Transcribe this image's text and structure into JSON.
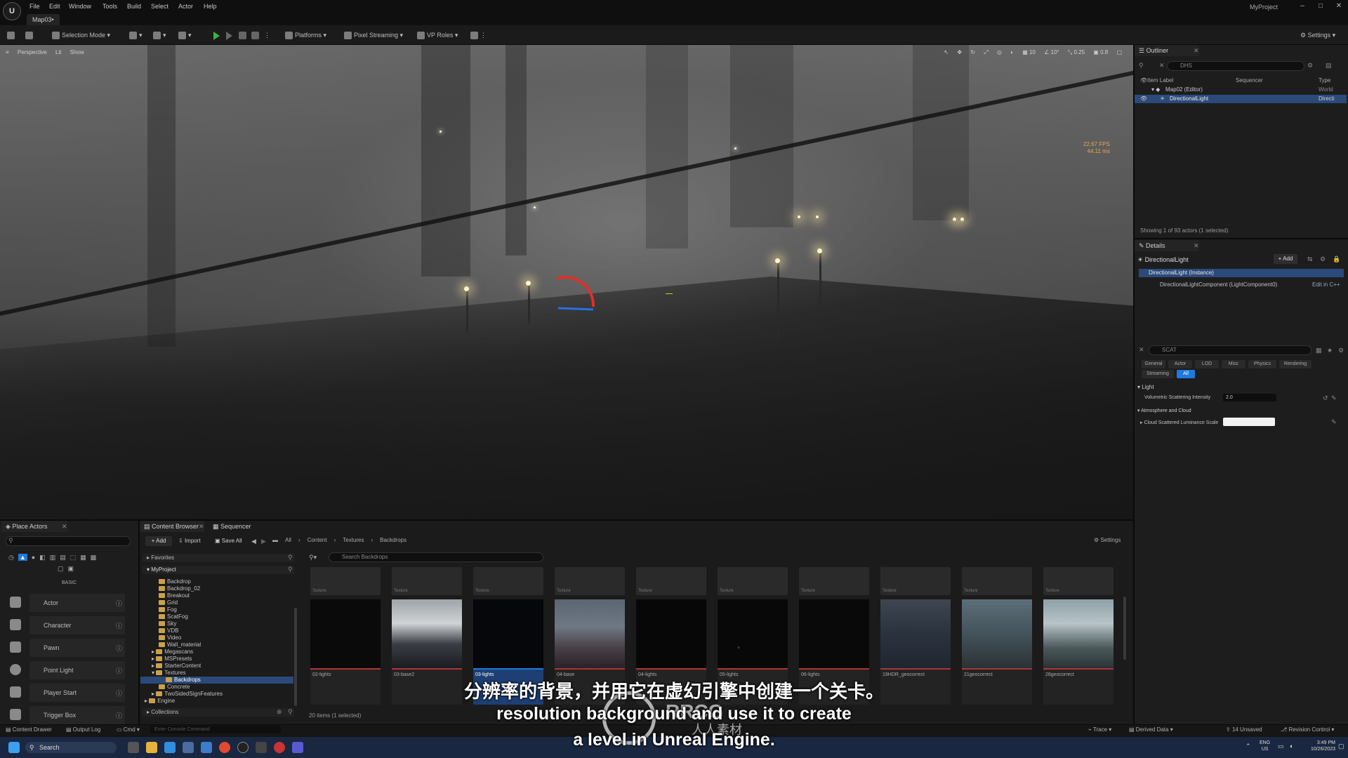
{
  "app": {
    "menu": [
      "File",
      "Edit",
      "Window",
      "Tools",
      "Build",
      "Select",
      "Actor",
      "Help"
    ],
    "project_name": "MyProject",
    "map_tab": "Map03•"
  },
  "toolbar": {
    "selection_mode": "Selection Mode",
    "platforms": "Platforms",
    "pixel_streaming": "Pixel Streaming",
    "vp_roles": "VP Roles",
    "settings": "Settings"
  },
  "viewport": {
    "perspective": "Perspective",
    "lit": "Lit",
    "show": "Show",
    "grid_value": "10",
    "angle_value": "10°",
    "scale_value": "0.25",
    "camera_speed": "0.8",
    "fps": "22.67 FPS",
    "ms": "44.11 ms"
  },
  "outliner": {
    "tab": "Outliner",
    "search": "DHS",
    "col_label": "Item Label",
    "col_sequencer": "Sequencer",
    "col_type": "Type",
    "rows": [
      {
        "label": "Map02 (Editor)",
        "type": "World"
      },
      {
        "label": "DirectionalLight",
        "type": "Directi"
      }
    ],
    "status": "Showing 1 of 93 actors (1 selected)"
  },
  "details": {
    "tab": "Details",
    "actor_name": "DirectionalLight",
    "add_label": "+ Add",
    "instance": "DirectionalLight (Instance)",
    "component": "DirectionalLightComponent (LightComponent0)",
    "edit_cpp": "Edit in C++",
    "search": "SCAT",
    "filters": [
      "General",
      "Actor",
      "LOD",
      "Misc",
      "Physics",
      "Rendering",
      "Streaming",
      "All"
    ],
    "section_light": "Light",
    "prop_volumetric": "Volumetric Scattering Intensity",
    "prop_volumetric_value": "2.0",
    "section_atmos": "Atmosphere and Cloud",
    "prop_cloud": "Cloud Scattered Luminance Scale"
  },
  "place_actors": {
    "tab": "Place Actors",
    "section": "BASIC",
    "items": [
      "Actor",
      "Character",
      "Pawn",
      "Point Light",
      "Player Start",
      "Trigger Box"
    ]
  },
  "content_browser": {
    "tab": "Content Browser",
    "tab2": "Sequencer",
    "add": "+ Add",
    "import": "Import",
    "save_all": "Save All",
    "breadcrumb": [
      "All",
      "Content",
      "Textures",
      "Backdrops"
    ],
    "settings": "Settings",
    "favorites": "Favorites",
    "project": "MyProject",
    "search_placeholder": "Search Backdrops",
    "folders": [
      "Backdrop",
      "Backdrop_02",
      "Breakout",
      "Grid",
      "Fog",
      "ScatFog",
      "Sky",
      "VDB",
      "Video",
      "Wall_material",
      "Megascans",
      "MSPresets",
      "StarterContent",
      "Textures",
      "Backdrops",
      "Concrete",
      "TwoSidedSignFeatures",
      "Engine"
    ],
    "collections": "Collections",
    "item_count": "20 items (1 selected)",
    "assets": [
      {
        "name": "02-lights",
        "type": "Texture"
      },
      {
        "name": "03-base2",
        "type": "Texture"
      },
      {
        "name": "03-lights",
        "type": "Texture"
      },
      {
        "name": "04-base",
        "type": "Texture"
      },
      {
        "name": "04-lights",
        "type": "Texture"
      },
      {
        "name": "05-lights",
        "type": "Texture"
      },
      {
        "name": "06-lights",
        "type": "Texture"
      },
      {
        "name": "19HDR_geocorrect",
        "type": "Texture"
      },
      {
        "name": "21geocorrect",
        "type": "Texture"
      },
      {
        "name": "28geocorrect",
        "type": "Texture"
      }
    ]
  },
  "status": {
    "content_drawer": "Content Drawer",
    "output_log": "Output Log",
    "cmd": "Cmd",
    "console_placeholder": "Enter Console Command",
    "trace": "Trace",
    "derived_data": "Derived Data",
    "unsaved": "14 Unsaved",
    "revision_control": "Revision Control"
  },
  "taskbar": {
    "search": "Search",
    "lang": "ENG",
    "lang2": "US",
    "time": "3:49 PM",
    "date": "10/26/2023"
  },
  "subtitles": {
    "cn": "分辨率的背景，并用它在虚幻引擎中创建一个关卡。",
    "en1": "resolution background and use it to create",
    "en2": "a level in Unreal Engine."
  },
  "watermark": {
    "brand": "RRCG",
    "cn": "人人素材"
  },
  "colors": {
    "selection": "#2b4a7a",
    "accent_blue": "#1e7ae0",
    "play_green": "#3bb33b"
  }
}
